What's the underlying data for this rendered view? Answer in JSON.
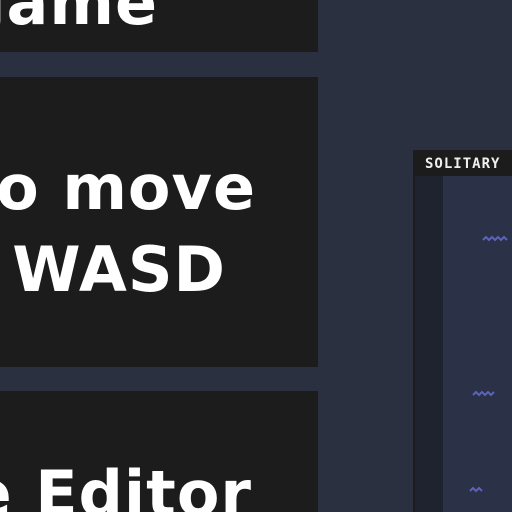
{
  "panels": {
    "top_text": "game",
    "mid_line1": "to move",
    "mid_line2": "WASD",
    "bottom_text": "e Editor"
  },
  "game": {
    "title": "SOLITARY",
    "colors": {
      "field": "#2b3146",
      "wave": "#5b64b8"
    }
  }
}
